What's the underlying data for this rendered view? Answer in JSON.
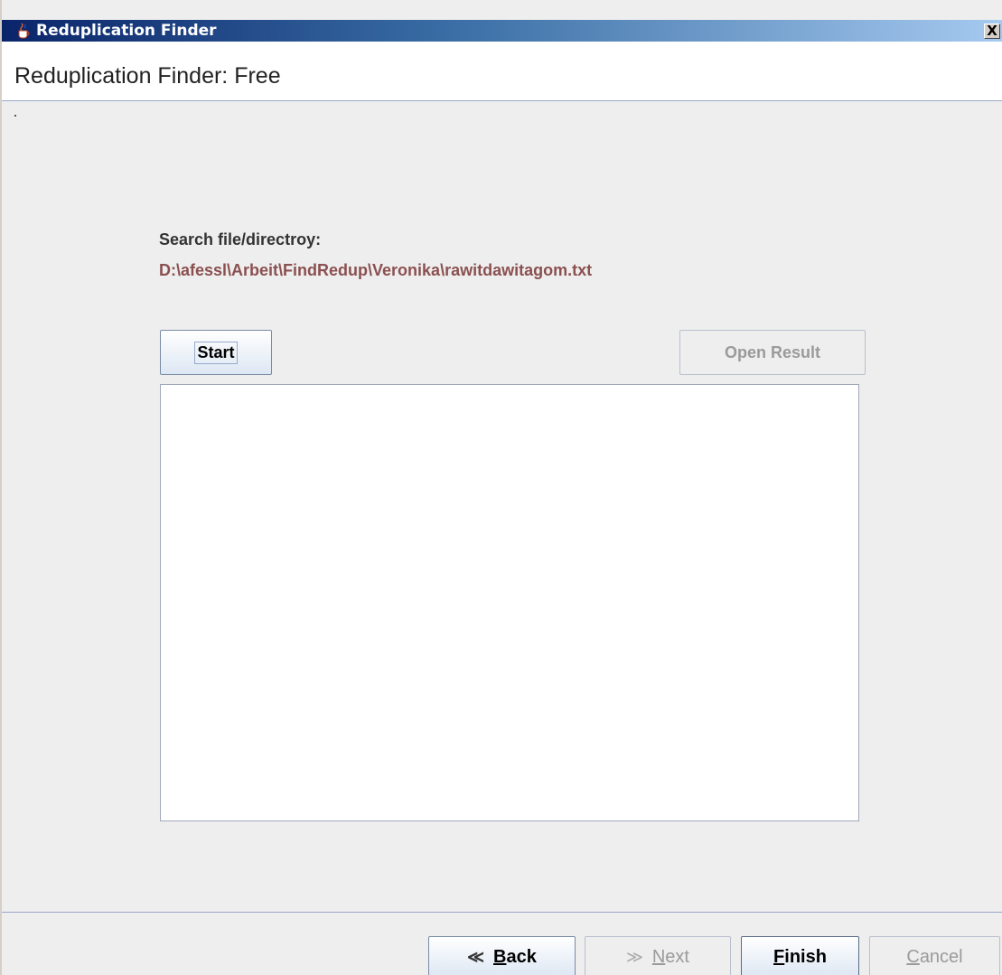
{
  "window": {
    "title": "Reduplication Finder",
    "close_label": "X"
  },
  "header": {
    "title": "Reduplication Finder: Free"
  },
  "main": {
    "search_label": "Search file/directroy:",
    "search_path": "D:\\afessl\\Arbeit\\FindRedup\\Veronika\\rawitdawitagom.txt",
    "start_label": "Start",
    "open_result_label": "Open Result",
    "result_text": ""
  },
  "footer": {
    "back": {
      "icon": "double-chevron-left-icon",
      "first": "B",
      "rest": "ack"
    },
    "next": {
      "icon": "double-chevron-right-icon",
      "first": "N",
      "rest": "ext"
    },
    "finish": {
      "first": "F",
      "rest": "inish"
    },
    "cancel": {
      "first": "C",
      "rest": "ancel"
    }
  },
  "colors": {
    "titlebar_start": "#0a246a",
    "titlebar_end": "#a6caf0",
    "path_text": "#8b5050",
    "disabled_text": "#9a9a9a"
  }
}
